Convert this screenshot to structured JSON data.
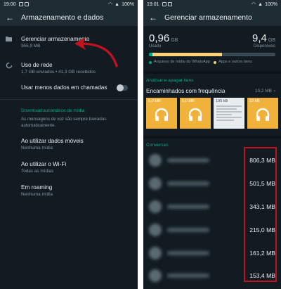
{
  "left": {
    "status": {
      "time": "19:00",
      "battery": "100%"
    },
    "header": {
      "title": "Armazenamento e dados"
    },
    "manage": {
      "title": "Gerenciar armazenamento",
      "size": "955,9 MB"
    },
    "network": {
      "title": "Uso de rede",
      "detail": "1,7 GB enviados • 41,3 GB recebidos"
    },
    "less_data": {
      "label": "Usar menos dados em chamadas"
    },
    "auto_download": {
      "header": "Download automático de mídia",
      "note": "As mensagens de voz são sempre baixadas automaticamente.",
      "items": [
        {
          "title": "Ao utilizar dados móveis",
          "value": "Nenhuma mídia"
        },
        {
          "title": "Ao utilizar o Wi-Fi",
          "value": "Todas as mídias"
        },
        {
          "title": "Em roaming",
          "value": "Nenhuma mídia"
        }
      ]
    },
    "colors": {
      "accent": "#00a884",
      "annotation": "#c1121f"
    }
  },
  "right": {
    "status": {
      "time": "19:01",
      "battery": "100%"
    },
    "header": {
      "title": "Gerenciar armazenamento"
    },
    "usage": {
      "used_value": "0,96",
      "used_unit": "GB",
      "used_label": "Usado",
      "free_value": "9,4",
      "free_unit": "GB",
      "free_label": "Disponíveis",
      "whatsapp_fraction": 0.03,
      "apps_fraction": 0.55,
      "legend_whatsapp": "Arquivos de mídia do WhatsApp",
      "legend_apps": "Apps e outros itens"
    },
    "review": {
      "header": "Analisar e apagar itens",
      "forwarded_title": "Encaminhados com frequência",
      "forwarded_size": "10,2 MB",
      "thumbs": [
        "5,0 MB",
        "5,0 MB",
        "195 kB",
        "13 kB"
      ]
    },
    "chats": {
      "header": "Conversas",
      "sizes": [
        "806,3 MB",
        "501,5 MB",
        "343,1 MB",
        "215,0 MB",
        "161,2 MB",
        "153,4 MB"
      ]
    },
    "colors": {
      "used_bar": "#ffd279",
      "whatsapp_bar": "#00a884"
    }
  }
}
